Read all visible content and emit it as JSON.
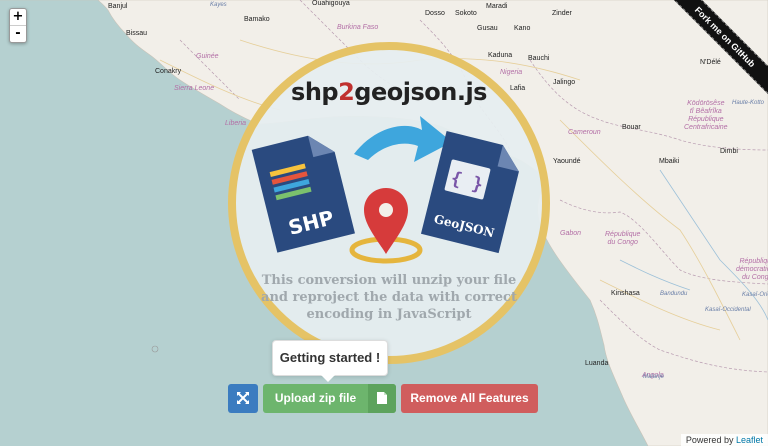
{
  "map": {
    "cities": [
      {
        "label": "Banjul",
        "cls": "place",
        "l": 108,
        "t": 3
      },
      {
        "label": "Bamako",
        "cls": "place",
        "l": 244,
        "t": 16
      },
      {
        "label": "Ouahigouya",
        "cls": "place",
        "l": 312,
        "t": 0
      },
      {
        "label": "Dosso",
        "cls": "place",
        "l": 425,
        "t": 10
      },
      {
        "label": "Sokoto",
        "cls": "place",
        "l": 455,
        "t": 10
      },
      {
        "label": "Zinder",
        "cls": "place",
        "l": 552,
        "t": 10
      },
      {
        "label": "Maradi",
        "cls": "place",
        "l": 486,
        "t": 3
      },
      {
        "label": "Gusau",
        "cls": "place",
        "l": 477,
        "t": 25
      },
      {
        "label": "Kano",
        "cls": "place",
        "l": 514,
        "t": 25
      },
      {
        "label": "Bissau",
        "cls": "place",
        "l": 126,
        "t": 30
      },
      {
        "label": "Kaduna",
        "cls": "place",
        "l": 488,
        "t": 52
      },
      {
        "label": "Bauchi",
        "cls": "place",
        "l": 528,
        "t": 55
      },
      {
        "label": "Conakry",
        "cls": "place",
        "l": 155,
        "t": 68
      },
      {
        "label": "Jalingo",
        "cls": "place",
        "l": 553,
        "t": 79
      },
      {
        "label": "N'Délé",
        "cls": "place",
        "l": 700,
        "t": 59
      },
      {
        "label": "Yaoundé",
        "cls": "place",
        "l": 553,
        "t": 158
      },
      {
        "label": "Bouar",
        "cls": "place",
        "l": 622,
        "t": 124
      },
      {
        "label": "Mbaiki",
        "cls": "place",
        "l": 659,
        "t": 158
      },
      {
        "label": "Dimbi",
        "cls": "place",
        "l": 720,
        "t": 148
      },
      {
        "label": "Kinshasa",
        "cls": "place",
        "l": 611,
        "t": 290
      },
      {
        "label": "Luanda",
        "cls": "place",
        "l": 585,
        "t": 360
      },
      {
        "label": "Lafia",
        "cls": "place",
        "l": 510,
        "t": 85
      }
    ],
    "countries": [
      {
        "label": "Burkina Faso",
        "l": 337,
        "t": 24
      },
      {
        "label": "Nigeria",
        "l": 500,
        "t": 69
      },
      {
        "label": "Guinée",
        "l": 196,
        "t": 53
      },
      {
        "label": "Sierra Leone",
        "l": 174,
        "t": 85
      },
      {
        "label": "Liberia",
        "l": 225,
        "t": 120
      },
      {
        "label": "Cameroun",
        "l": 568,
        "t": 129
      },
      {
        "label": "Gabon",
        "l": 560,
        "t": 230
      },
      {
        "label": "République\ndu Congo",
        "l": 605,
        "t": 231
      },
      {
        "label": "Ködörösêse\ntî Bêafrîka\nRépublique\nCentrafricaine",
        "l": 684,
        "t": 100
      },
      {
        "label": "République\ndémocratique\ndu Congo",
        "l": 736,
        "t": 258
      },
      {
        "label": "Angola",
        "l": 642,
        "t": 372
      }
    ],
    "small_labels": [
      {
        "label": "Kasaï-Oriental",
        "l": 742,
        "t": 292
      },
      {
        "label": "Kasaï-Occidental",
        "l": 705,
        "t": 307
      },
      {
        "label": "Bandundu",
        "l": 660,
        "t": 291
      },
      {
        "label": "Malanje",
        "l": 643,
        "t": 374
      },
      {
        "label": "Haute-Kotto",
        "l": 732,
        "t": 100
      },
      {
        "label": "Kayes",
        "l": 210,
        "t": 2
      }
    ]
  },
  "zoom": {
    "in": "+",
    "out": "-"
  },
  "ribbon": "Fork me on GitHub",
  "attribution": {
    "prefix": "Powered by",
    "link": "Leaflet"
  },
  "logo": {
    "title_a": "shp",
    "title_b": "2",
    "title_c": "geojson.js",
    "shp_label": "SHP",
    "geojson_label": "GeoJSON",
    "description": "This conversion will unzip your file and reproject the data with correct encoding in JavaScript"
  },
  "tooltip": "Getting started !",
  "buttons": {
    "upload": "Upload zip file",
    "remove": "Remove All Features"
  },
  "colors": {
    "expand": "#3b7cc0",
    "upload": "#6db56d",
    "remove": "#d05d5d",
    "ring": "#e5c366",
    "accent": "#c0302e"
  }
}
